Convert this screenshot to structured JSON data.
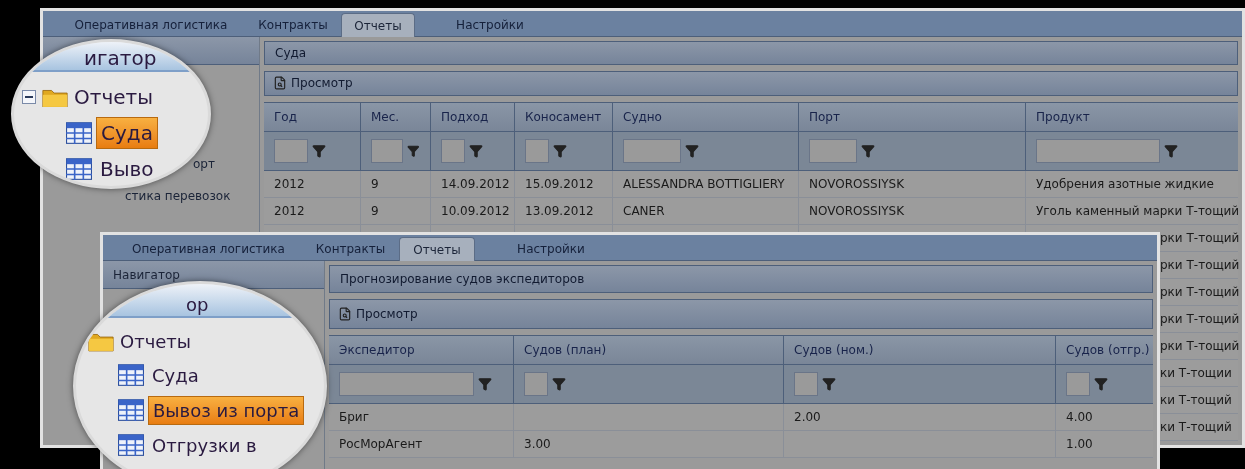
{
  "windows": [
    {
      "tabs": [
        {
          "label": "Оперативная логистика",
          "selected": false
        },
        {
          "label": "Контракты",
          "selected": false
        },
        {
          "label": "Отчеты",
          "selected": true
        },
        {
          "label": "Настройки",
          "selected": false
        }
      ],
      "navigator": {
        "items": [
          "орт",
          "стика перевозок"
        ]
      },
      "panel": {
        "title": "Суда",
        "toolbar": {
          "button": "Просмотр"
        },
        "table": {
          "columns": [
            "Год",
            "Мес.",
            "Подход",
            "Коносамент",
            "Судно",
            "Порт",
            "Продукт"
          ],
          "rows": [
            {
              "kind": "full",
              "cells": [
                {
                  "kind": "text",
                  "text": "2012"
                },
                {
                  "kind": "text",
                  "text": "9"
                },
                {
                  "kind": "text",
                  "text": "14.09.2012"
                },
                {
                  "kind": "text",
                  "text": "15.09.2012"
                },
                {
                  "kind": "text",
                  "text": "ALESSANDRA BOTTIGLIERY"
                },
                {
                  "kind": "text",
                  "text": "NOVOROSSIYSK"
                },
                {
                  "kind": "text",
                  "text": "Удобрения азотные жидкие"
                }
              ]
            },
            {
              "kind": "full",
              "cells": [
                {
                  "kind": "text",
                  "text": "2012"
                },
                {
                  "kind": "text",
                  "text": "9"
                },
                {
                  "kind": "text",
                  "text": "10.09.2012"
                },
                {
                  "kind": "text",
                  "text": "13.09.2012"
                },
                {
                  "kind": "text",
                  "text": "CANER"
                },
                {
                  "kind": "text",
                  "text": "NOVOROSSIYSK"
                },
                {
                  "kind": "text",
                  "text": "Уголь каменный марки Т-тощий"
                }
              ]
            },
            {
              "kind": "tail",
              "cells": [
                {
                  "kind": "text",
                  "text": "рки Т-тощий"
                }
              ]
            },
            {
              "kind": "tail",
              "cells": [
                {
                  "kind": "text",
                  "text": "рки Т-тощий"
                }
              ]
            },
            {
              "kind": "tail",
              "cells": [
                {
                  "kind": "text",
                  "text": "рки Т-тощий"
                }
              ]
            },
            {
              "kind": "tail",
              "cells": [
                {
                  "kind": "text",
                  "text": "рки Т-тощий"
                }
              ]
            },
            {
              "kind": "tail",
              "cells": [
                {
                  "kind": "text",
                  "text": "рки Т-тощий"
                }
              ]
            },
            {
              "kind": "tail",
              "cells": [
                {
                  "kind": "text",
                  "text": "ки Т-тощии"
                }
              ]
            },
            {
              "kind": "tail",
              "cells": [
                {
                  "kind": "text",
                  "text": "ки Т-тощий"
                }
              ]
            },
            {
              "kind": "tail",
              "cells": [
                {
                  "kind": "text",
                  "text": "ки Т-тощий"
                }
              ]
            }
          ]
        }
      },
      "magnifier": {
        "header": "игатор",
        "tree": {
          "label": "Отчеты",
          "expanded": true,
          "children": [
            {
              "label": "Суда",
              "selected": true
            },
            {
              "label": "Выво",
              "selected": false
            }
          ]
        }
      }
    },
    {
      "tabs": [
        {
          "label": "Оперативная логистика",
          "selected": false
        },
        {
          "label": "Контракты",
          "selected": false
        },
        {
          "label": "Отчеты",
          "selected": true
        },
        {
          "label": "Настройки",
          "selected": false
        }
      ],
      "navigator": {
        "header": "Навигатор"
      },
      "panel": {
        "title": "Прогнозирование судов экспедиторов",
        "toolbar": {
          "button": "Просмотр"
        },
        "table": {
          "columns": [
            "Экспедитор",
            "Судов (план)",
            "Судов (ном.)",
            "Судов (отгр.)"
          ],
          "rows": [
            {
              "kind": "full",
              "cells": [
                {
                  "kind": "text",
                  "text": "Бриг"
                },
                {
                  "kind": "empty"
                },
                {
                  "kind": "text",
                  "text": "2.00"
                },
                {
                  "kind": "text",
                  "text": "4.00"
                }
              ]
            },
            {
              "kind": "full",
              "cells": [
                {
                  "kind": "text",
                  "text": "РосМорАгент"
                },
                {
                  "kind": "text",
                  "text": "3.00"
                },
                {
                  "kind": "empty"
                },
                {
                  "kind": "text",
                  "text": "1.00"
                }
              ]
            }
          ]
        }
      },
      "magnifier": {
        "header": "ор",
        "tree": {
          "label": "Отчеты",
          "children": [
            {
              "label": "Суда",
              "selected": false
            },
            {
              "label": "Вывоз из порта",
              "selected": true
            },
            {
              "label": "Отгрузки в",
              "selected": false
            }
          ]
        }
      }
    }
  ]
}
